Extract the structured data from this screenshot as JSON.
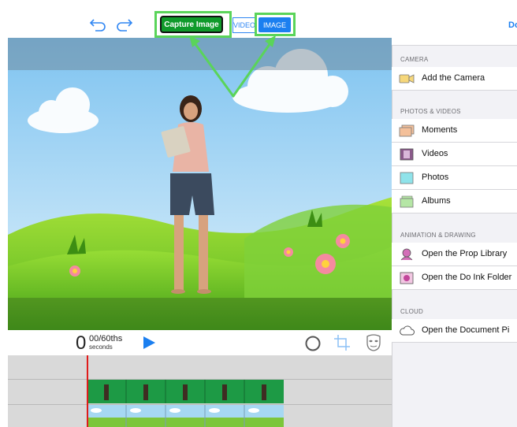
{
  "toolbar": {
    "capture_label": "Capture Image",
    "video_label": "VIDEO",
    "image_label": "IMAGE"
  },
  "playback": {
    "seconds_value": "0",
    "fraction_label": "00/60ths",
    "unit_label": "seconds"
  },
  "sidebar": {
    "done_label": "Do",
    "sections": [
      {
        "header": "CAMERA",
        "items": [
          {
            "label": "Add the Camera",
            "icon": "camera-icon"
          }
        ]
      },
      {
        "header": "PHOTOS & VIDEOS",
        "items": [
          {
            "label": "Moments",
            "icon": "moments-icon"
          },
          {
            "label": "Videos",
            "icon": "film-icon"
          },
          {
            "label": "Photos",
            "icon": "photos-icon"
          },
          {
            "label": "Albums",
            "icon": "albums-icon"
          }
        ]
      },
      {
        "header": "ANIMATION & DRAWING",
        "items": [
          {
            "label": "Open the Prop Library",
            "icon": "prop-library-icon"
          },
          {
            "label": "Open the Do Ink Folder",
            "icon": "doink-folder-icon"
          }
        ]
      },
      {
        "header": "CLOUD",
        "items": [
          {
            "label": "Open the Document Pi",
            "icon": "cloud-icon"
          }
        ]
      }
    ]
  },
  "colors": {
    "accent": "#1b7ff0",
    "capture": "#0f9a2a",
    "highlight": "#5ad45a",
    "playhead": "#e01b1b"
  }
}
